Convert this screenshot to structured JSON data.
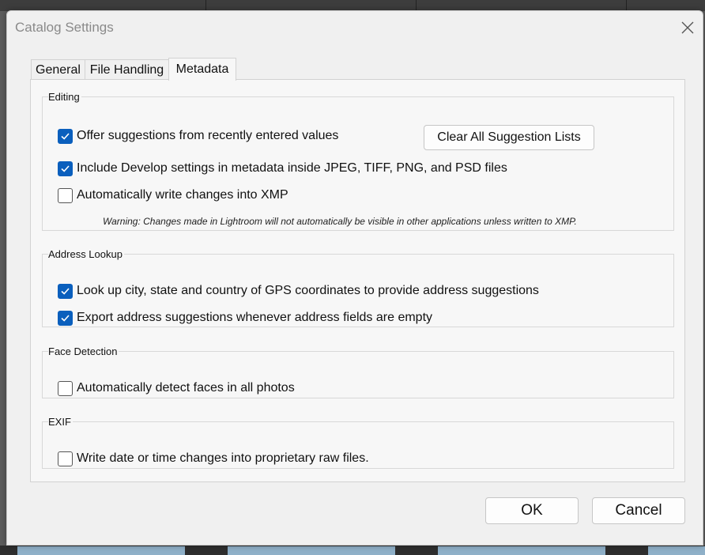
{
  "window": {
    "title": "Catalog Settings"
  },
  "tabs": [
    {
      "label": "General",
      "active": false
    },
    {
      "label": "File Handling",
      "active": false
    },
    {
      "label": "Metadata",
      "active": true
    }
  ],
  "editing": {
    "legend": "Editing",
    "offer_suggestions": {
      "label": "Offer suggestions from recently entered values",
      "checked": true
    },
    "include_develop": {
      "label": "Include Develop settings in metadata inside JPEG, TIFF, PNG, and PSD files",
      "checked": true
    },
    "auto_write_xmp": {
      "label": "Automatically write changes into XMP",
      "checked": false
    },
    "clear_button": "Clear All Suggestion Lists",
    "warning": "Warning: Changes made in Lightroom will not automatically be visible in other applications unless written to XMP."
  },
  "address_lookup": {
    "legend": "Address Lookup",
    "lookup_gps": {
      "label": "Look up city, state and country of GPS coordinates to provide address suggestions",
      "checked": true
    },
    "export_suggestions": {
      "label": "Export address suggestions whenever address fields are empty",
      "checked": true
    }
  },
  "face_detection": {
    "legend": "Face Detection",
    "auto_detect": {
      "label": "Automatically detect faces in all photos",
      "checked": false
    }
  },
  "exif": {
    "legend": "EXIF",
    "write_date": {
      "label": "Write date or time changes into proprietary raw files.",
      "checked": false
    }
  },
  "footer": {
    "ok": "OK",
    "cancel": "Cancel"
  },
  "colors": {
    "accent": "#0a5fbd",
    "dialog_bg": "#f0f0f0",
    "panel_bg": "#f7f7f7"
  }
}
